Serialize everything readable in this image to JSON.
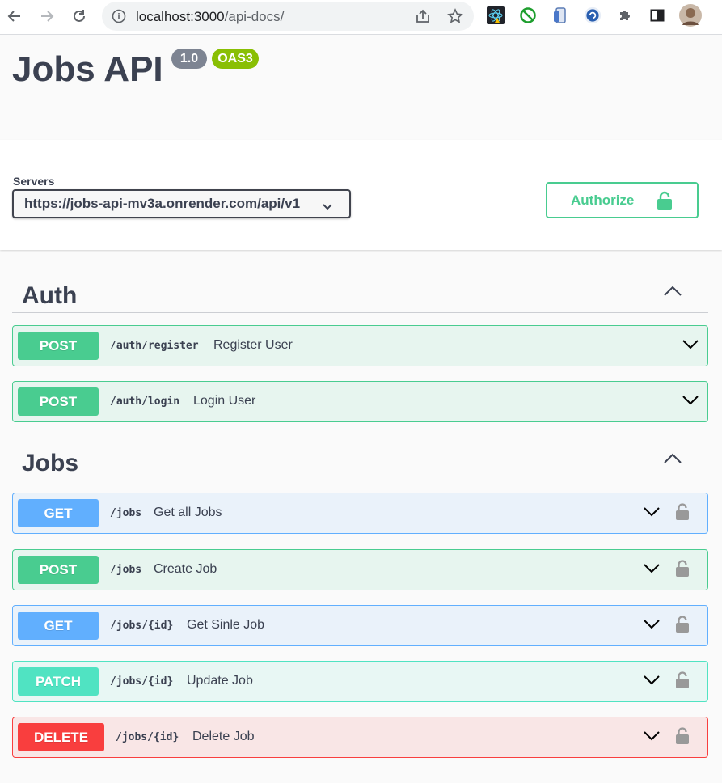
{
  "browser": {
    "url_host": "localhost:3000",
    "url_path": "/api-docs/"
  },
  "info": {
    "title": "Jobs API",
    "version": "1.0",
    "oas": "OAS3"
  },
  "scheme": {
    "servers_label": "Servers",
    "selected_server": "https://jobs-api-mv3a.onrender.com/api/v1",
    "authorize_label": "Authorize"
  },
  "sections": [
    {
      "name": "Auth",
      "operations": [
        {
          "method": "POST",
          "path": "/auth/register",
          "summary": "Register User"
        },
        {
          "method": "POST",
          "path": "/auth/login",
          "summary": "Login User"
        }
      ]
    },
    {
      "name": "Jobs",
      "operations": [
        {
          "method": "GET",
          "path": "/jobs",
          "summary": "Get all Jobs"
        },
        {
          "method": "POST",
          "path": "/jobs",
          "summary": "Create Job"
        },
        {
          "method": "GET",
          "path": "/jobs/{id}",
          "summary": "Get Sinle Job"
        },
        {
          "method": "PATCH",
          "path": "/jobs/{id}",
          "summary": "Update Job"
        },
        {
          "method": "DELETE",
          "path": "/jobs/{id}",
          "summary": "Delete Job"
        }
      ]
    }
  ],
  "colors": {
    "post": "#49cc90",
    "get": "#61affe",
    "patch": "#50e3c2",
    "delete": "#f93e3e",
    "version_badge": "#7d8492",
    "oas_badge": "#89bf04"
  },
  "icons": {
    "back": "arrow-left-icon",
    "forward": "arrow-right-icon",
    "reload": "reload-icon",
    "info": "info-icon",
    "share": "share-icon",
    "bookmark": "star-icon",
    "extensions": "puzzle-icon",
    "side_panel": "side-panel-icon",
    "lock": "lock-icon",
    "chevron_down": "chevron-down-icon",
    "chevron_up": "chevron-up-icon"
  }
}
